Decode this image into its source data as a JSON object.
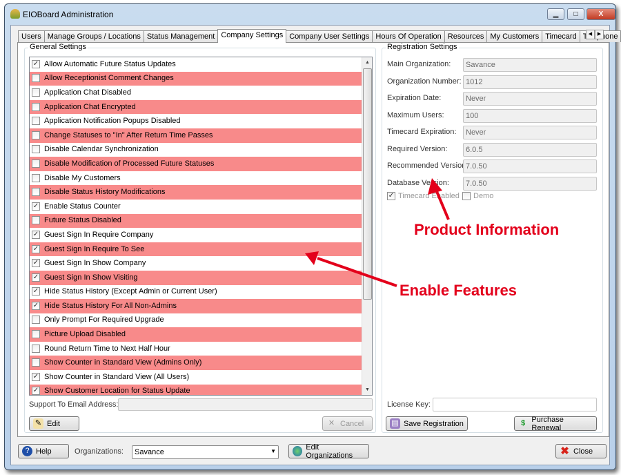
{
  "window": {
    "title": "EIOBoard Administration",
    "minimize": "▁",
    "maximize": "□",
    "close": "X"
  },
  "tabs": [
    {
      "label": "Users"
    },
    {
      "label": "Manage Groups / Locations"
    },
    {
      "label": "Status Management"
    },
    {
      "label": "Company Settings",
      "active": true
    },
    {
      "label": "Company User Settings"
    },
    {
      "label": "Hours Of Operation"
    },
    {
      "label": "Resources"
    },
    {
      "label": "My Customers"
    },
    {
      "label": "Timecard"
    },
    {
      "label": "Telephone"
    }
  ],
  "tab_scroll": {
    "left": "◀",
    "right": "▶"
  },
  "general": {
    "title": "General Settings",
    "items": [
      {
        "label": "Allow Automatic Future Status Updates",
        "checked": true
      },
      {
        "label": "Allow Receptionist Comment Changes",
        "checked": false
      },
      {
        "label": "Application Chat Disabled",
        "checked": false
      },
      {
        "label": "Application Chat Encrypted",
        "checked": false
      },
      {
        "label": "Application Notification Popups Disabled",
        "checked": false
      },
      {
        "label": "Change Statuses to \"In\" After Return Time Passes",
        "checked": false
      },
      {
        "label": "Disable Calendar Synchronization",
        "checked": false
      },
      {
        "label": "Disable Modification of Processed Future Statuses",
        "checked": false
      },
      {
        "label": "Disable My Customers",
        "checked": false
      },
      {
        "label": "Disable Status History Modifications",
        "checked": false
      },
      {
        "label": "Enable Status Counter",
        "checked": true
      },
      {
        "label": "Future Status Disabled",
        "checked": false
      },
      {
        "label": "Guest Sign In Require Company",
        "checked": true
      },
      {
        "label": "Guest Sign In Require To See",
        "checked": true
      },
      {
        "label": "Guest Sign In Show Company",
        "checked": true
      },
      {
        "label": "Guest Sign In Show Visiting",
        "checked": true
      },
      {
        "label": "Hide Status History (Except Admin or Current User)",
        "checked": true
      },
      {
        "label": "Hide Status History For All Non-Admins",
        "checked": true
      },
      {
        "label": "Only Prompt For Required Upgrade",
        "checked": false
      },
      {
        "label": "Picture Upload Disabled",
        "checked": false
      },
      {
        "label": "Round Return Time to Next Half Hour",
        "checked": false
      },
      {
        "label": "Show Counter in Standard View (Admins Only)",
        "checked": false
      },
      {
        "label": "Show Counter in Standard View (All Users)",
        "checked": true
      },
      {
        "label": "Show Customer Location for Status Update",
        "checked": true
      }
    ],
    "support_email_label": "Support To Email Address:",
    "support_email_value": "",
    "edit": "Edit",
    "cancel": "Cancel"
  },
  "registration": {
    "title": "Registration Settings",
    "fields": [
      {
        "label": "Main Organization:",
        "value": "Savance"
      },
      {
        "label": "Organization Number:",
        "value": "1012"
      },
      {
        "label": "Expiration Date:",
        "value": "Never"
      },
      {
        "label": "Maximum Users:",
        "value": "100"
      },
      {
        "label": "Timecard Expiration:",
        "value": "Never"
      },
      {
        "label": "Required Version:",
        "value": "6.0.5"
      },
      {
        "label": "Recommended Version:",
        "value": "7.0.50"
      },
      {
        "label": "Database Version:",
        "value": "7.0.50"
      }
    ],
    "timecard_enabled": {
      "label": "Timecard Enabled",
      "checked": true
    },
    "demo": {
      "label": "Demo",
      "checked": false
    },
    "license_key_label": "License Key:",
    "license_key_value": "",
    "save": "Save Registration",
    "purchase": "Purchase Renewal"
  },
  "footer": {
    "help": "Help",
    "organizations_label": "Organizations:",
    "organization_value": "Savance",
    "edit_orgs": "Edit Organizations",
    "close": "Close"
  },
  "annotations": {
    "product": "Product Information",
    "features": "Enable Features"
  },
  "colors": {
    "highlight_row": "#f88a8a",
    "annotation": "#e3001b"
  }
}
